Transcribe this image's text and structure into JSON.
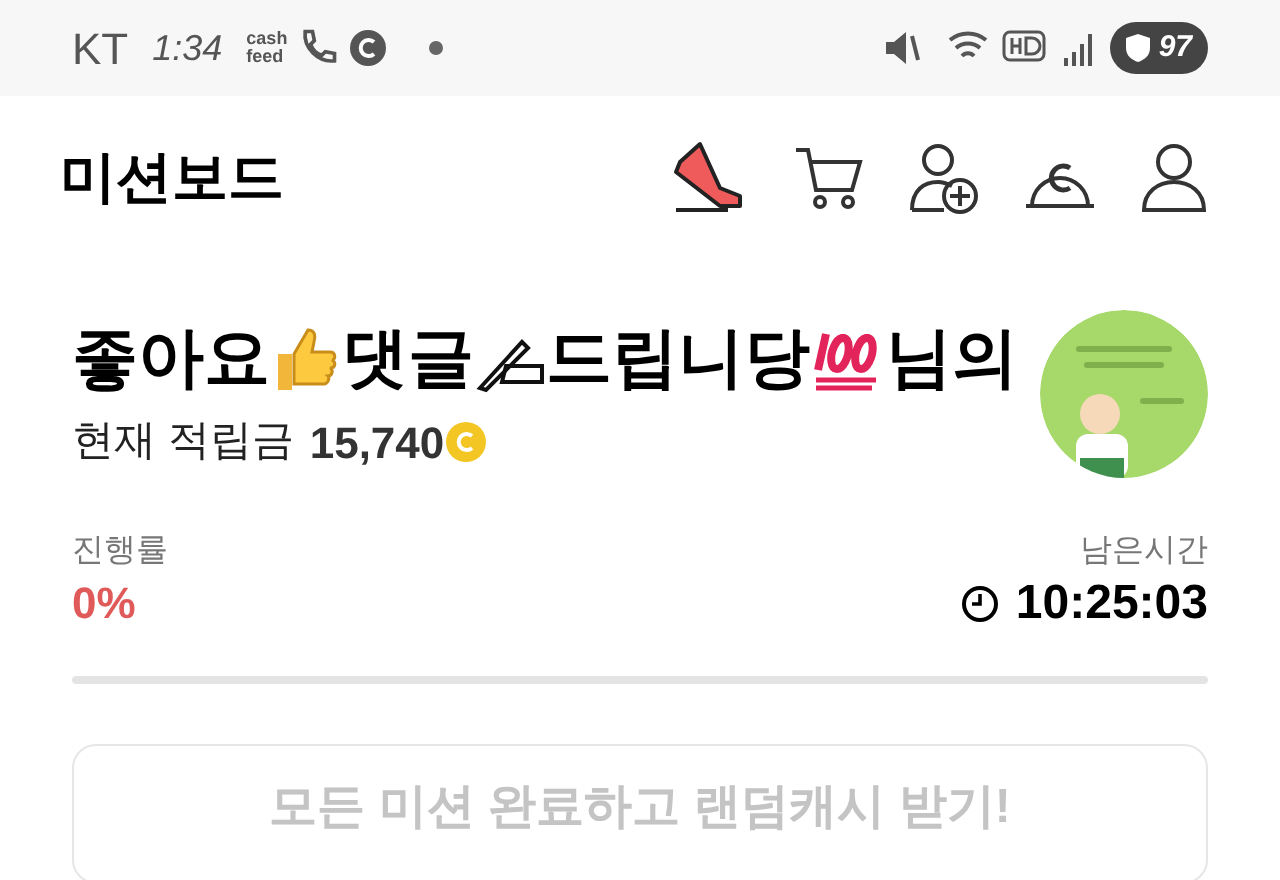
{
  "status_bar": {
    "carrier": "KT",
    "time": "1:34",
    "cashfeed": [
      "cash",
      "feed"
    ],
    "battery": "97"
  },
  "header": {
    "title": "미션보드"
  },
  "profile": {
    "name_parts": [
      {
        "kind": "text",
        "text": "좋아요"
      },
      {
        "kind": "thumbs"
      },
      {
        "kind": "text",
        "text": "댓글"
      },
      {
        "kind": "writing"
      },
      {
        "kind": "text",
        "text": "드립니당"
      },
      {
        "kind": "hundred"
      },
      {
        "kind": "text",
        "text": "님의"
      }
    ],
    "balance_label": "현재 적립금",
    "balance": "15,740"
  },
  "progress": {
    "label": "진행률",
    "value": "0%",
    "level": 0,
    "remaining_label": "남은시간",
    "remaining": "10:25:03"
  },
  "reward_button": {
    "label": "모든 미션 완료하고 랜덤캐시 받기!",
    "disabled": true
  }
}
